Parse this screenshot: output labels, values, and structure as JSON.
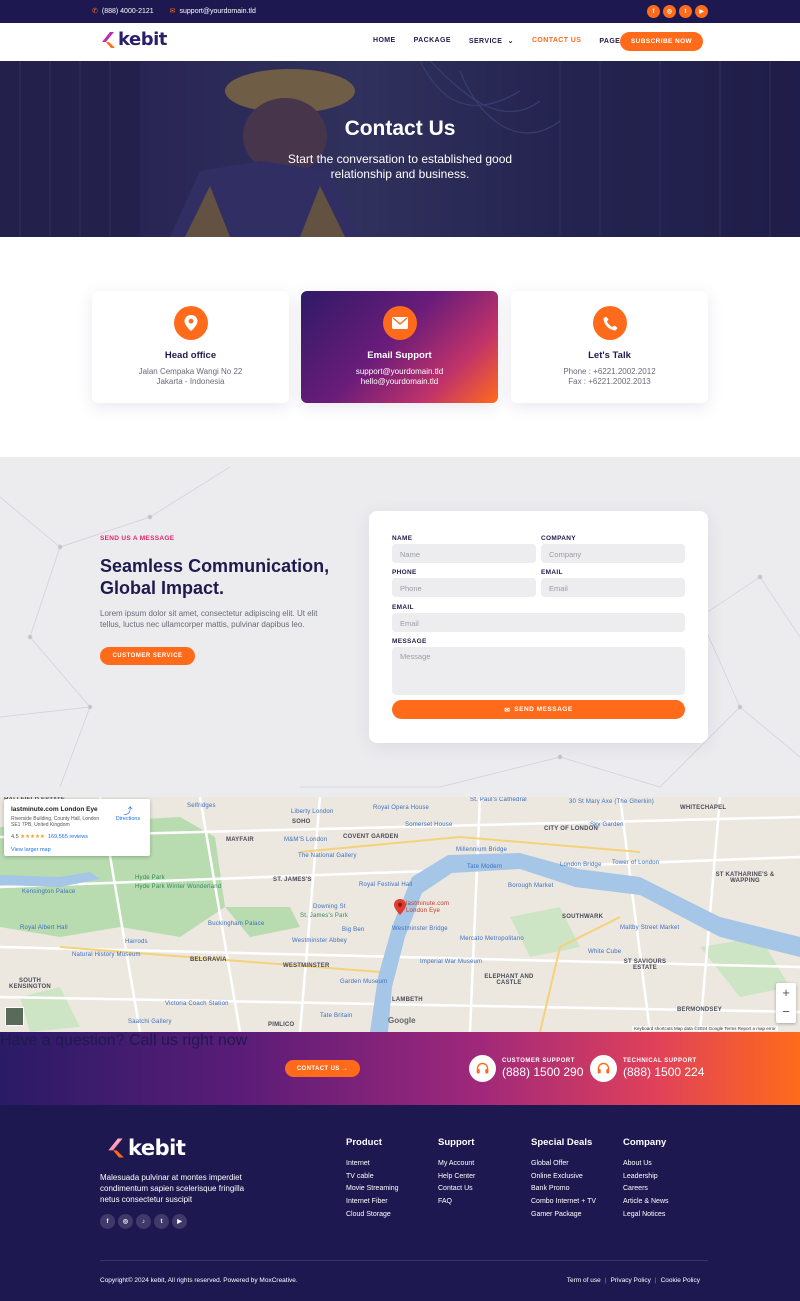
{
  "topbar": {
    "phone": "(888) 4000-2121",
    "email": "support@yourdomain.tld",
    "socials": [
      "facebook-icon",
      "instagram-icon",
      "twitter-icon",
      "youtube-icon"
    ]
  },
  "brand": {
    "name": "kebit",
    "accent": "#ff6b1a",
    "navy": "#1e1850"
  },
  "nav": {
    "items": [
      {
        "label": "HOME"
      },
      {
        "label": "PACKAGE"
      },
      {
        "label": "SERVICE",
        "dropdown": true
      },
      {
        "label": "CONTACT US",
        "active": true
      },
      {
        "label": "PAGES",
        "dropdown": true
      }
    ],
    "cta": "SUBSCRIBE NOW"
  },
  "hero": {
    "title": "Contact Us",
    "subtitle": "Start the conversation to established good relationship and business."
  },
  "cards": [
    {
      "icon": "location-pin-icon",
      "title": "Head office",
      "lines": [
        "Jalan Cempaka Wangi No 22",
        "Jakarta - Indonesia"
      ]
    },
    {
      "icon": "mail-icon",
      "title": "Email Support",
      "lines": [
        "support@yourdomain.tld",
        "hello@yourdomain.tld"
      ]
    },
    {
      "icon": "phone-icon",
      "title": "Let's Talk",
      "lines": [
        "Phone : +6221.2002.2012",
        "Fax : +6221.2002.2013"
      ]
    }
  ],
  "contact": {
    "eyebrow": "SEND US A MESSAGE",
    "headline": "Seamless Communication, Global Impact.",
    "body": "Lorem ipsum dolor sit amet, consectetur adipiscing elit. Ut elit tellus, luctus nec ullamcorper mattis, pulvinar dapibus leo.",
    "button": "CUSTOMER SERVICE"
  },
  "form": {
    "name_label": "NAME",
    "name_placeholder": "Name",
    "company_label": "COMPANY",
    "company_placeholder": "Company",
    "phone_label": "PHONE",
    "phone_placeholder": "Phone",
    "email_label": "EMAIL",
    "email_placeholder": "Email",
    "email2_label": "EMAIL",
    "email2_placeholder": "Email",
    "message_label": "MESSAGE",
    "message_placeholder": "Message",
    "submit": "SEND MESSAGE"
  },
  "map": {
    "place_title": "lastminute.com London Eye",
    "place_address": "Riverside Building, County Hall, London SE1 7PB, United Kingdom",
    "rating": "4.5",
    "stars": "★★★★★",
    "reviews": "169,565 reviews",
    "directions": "Directions",
    "view_larger": "View larger map",
    "pin_label": "lastminute.com London Eye",
    "footer_text": "Keyboard shortcuts   Map data ©2024 Google   Terms   Report a map error",
    "google": "Google",
    "zoom_in": "+",
    "zoom_out": "−",
    "labels": [
      "HALLFIELD ESTATE",
      "Selfridges",
      "Liberty London",
      "SOHO",
      "Royal Opera House",
      "St. Paul's Cathedral",
      "30 St Mary Axe (The Gherkin)",
      "WHITECHAPEL",
      "MAYFAIR",
      "M&M'S London",
      "COVENT GARDEN",
      "Somerset House",
      "CITY OF LONDON",
      "Sky Garden",
      "Hyde Park",
      "The National Gallery",
      "Millennium Bridge",
      "Tower of London",
      "Kensington Palace",
      "Hyde Park Winter Wonderland",
      "ST. JAMES'S",
      "Royal Festival Hall",
      "Tate Modern",
      "Borough Market",
      "London Bridge",
      "ST KATHARINE'S & WAPPING",
      "Buckingham Palace",
      "St. James's Park",
      "Westminster Bridge",
      "Royal Albert Hall",
      "Harrods",
      "Westminster Abbey",
      "Big Ben",
      "Mercato Metropolitano",
      "Maltby Street Market",
      "White Cube",
      "Natural History Museum",
      "BELGRAVIA",
      "WESTMINSTER",
      "Imperial War Museum",
      "ST SAVIOURS ESTATE",
      "SOUTH KENSINGTON",
      "ELEPHANT AND CASTLE",
      "Garden Museum",
      "LAMBETH",
      "Victoria Coach Station",
      "BERMONDSEY",
      "Saatchi Gallery",
      "PIMLICO",
      "Tate Britain",
      "SOUTHWARK",
      "Downing St"
    ]
  },
  "cta": {
    "question": "Have a question? Call us right now",
    "button": "CONTACT US →",
    "customer_label": "CUSTOMER SUPPORT",
    "customer_phone": "(888) 1500 290",
    "technical_label": "TECHNICAL SUPPORT",
    "technical_phone": "(888) 1500 224"
  },
  "footer": {
    "logo": "kebit",
    "description": "Malesuada pulvinar at montes imperdiet condimentum sapien scelerisque fringilla netus consectetur suscipit",
    "socials": [
      "facebook-icon",
      "instagram-icon",
      "tiktok-icon",
      "twitter-icon",
      "youtube-icon"
    ],
    "columns": [
      {
        "title": "Product",
        "links": [
          "Internet",
          "TV cable",
          "Movie Streaming",
          "Internet Fiber",
          "Cloud Storage"
        ]
      },
      {
        "title": "Support",
        "links": [
          "My Account",
          "Help Center",
          "Contact Us",
          "FAQ"
        ]
      },
      {
        "title": "Special Deals",
        "links": [
          "Global Offer",
          "Online Exclusive",
          "Bank Promo",
          "Combo Internet + TV",
          "Gamer Package"
        ]
      },
      {
        "title": "Company",
        "links": [
          "About Us",
          "Leadership",
          "Careers",
          "Article & News",
          "Legal Notices"
        ]
      }
    ],
    "copyright": "Copyright© 2024 kebit, All rights reserved. Powered by MoxCreative.",
    "legal": [
      "Term of use",
      "Privacy Policy",
      "Cookie Policy"
    ]
  }
}
